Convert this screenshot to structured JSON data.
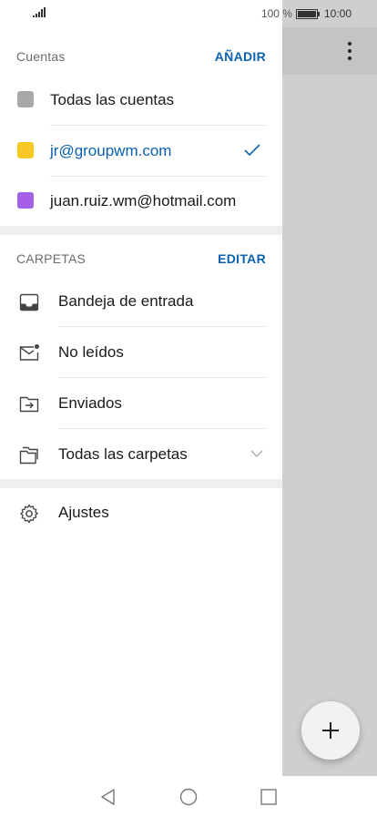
{
  "status": {
    "battery": "100 %",
    "time": "10:00"
  },
  "accounts": {
    "title": "Cuentas",
    "add_label": "AÑADIR",
    "items": [
      {
        "label": "Todas las cuentas",
        "color": "#a8a8a8",
        "text_color": "#1a1a1a",
        "selected": false
      },
      {
        "label": "jr@groupwm.com",
        "color": "#f7c824",
        "text_color": "#0a62b0",
        "selected": true
      },
      {
        "label": "juan.ruiz.wm@hotmail.com",
        "color": "#a55ee8",
        "text_color": "#1a1a1a",
        "selected": false
      }
    ]
  },
  "folders": {
    "title": "CARPETAS",
    "edit_label": "EDITAR",
    "items": [
      {
        "label": "Bandeja de entrada",
        "icon": "inbox-icon"
      },
      {
        "label": "No leídos",
        "icon": "unread-mail-icon"
      },
      {
        "label": "Enviados",
        "icon": "sent-icon"
      },
      {
        "label": "Todas las carpetas",
        "icon": "folders-icon"
      }
    ]
  },
  "settings": {
    "label": "Ajustes",
    "icon": "gear-icon"
  },
  "colors": {
    "accent": "#0a62b0",
    "divider": "#e6e6e6",
    "scrim": "#cfcfcf"
  }
}
